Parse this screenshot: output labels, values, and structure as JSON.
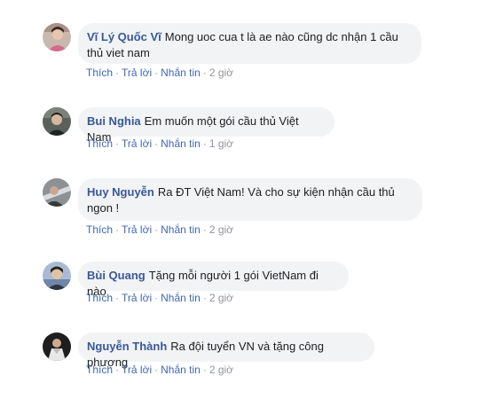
{
  "comments": [
    {
      "author": "Vĩ Lý Quốc Vĩ",
      "text": "Mong uoc cua t là ae nào cũng dc nhận 1 cầu thủ viet nam",
      "actions": {
        "like": "Thích",
        "reply": "Trả lời",
        "message": "Nhắn tin"
      },
      "time": "2 giờ",
      "avatar_color": "#b8a59b"
    },
    {
      "author": "Bui Nghia",
      "text": "Em muốn một gói cầu thủ Việt Nam",
      "actions": {
        "like": "Thích",
        "reply": "Trả lời",
        "message": "Nhắn tin"
      },
      "time": "1 giờ",
      "avatar_color": "#3a3f3a"
    },
    {
      "author": "Huy Nguyễn",
      "text": "Ra ĐT Việt Nam! Và cho sự kiện nhận cầu thủ ngon !",
      "actions": {
        "like": "Thích",
        "reply": "Trả lời",
        "message": "Nhắn tin"
      },
      "time": "2 giờ",
      "avatar_color": "#6b6f74"
    },
    {
      "author": "Bùi Quang",
      "text": "Tặng mỗi người 1 gói VietNam đi nào",
      "actions": {
        "like": "Thích",
        "reply": "Trả lời",
        "message": "Nhắn tin"
      },
      "time": "2 giờ",
      "avatar_color": "#8aa0bf"
    },
    {
      "author": "Nguyễn Thành",
      "text": "Ra đội tuyển VN và tặng công phượng",
      "actions": {
        "like": "Thích",
        "reply": "Trả lời",
        "message": "Nhắn tin"
      },
      "time": "2 giờ",
      "avatar_color": "#2b2b2b"
    }
  ]
}
